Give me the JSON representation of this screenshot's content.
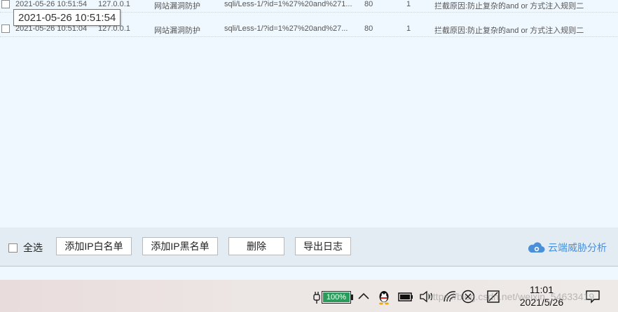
{
  "log_rows": [
    {
      "time": "2021-05-26 10:51:54",
      "ip": "127.0.0.1",
      "type": "网站漏洞防护",
      "url": "sqli/Less-1/?id=1%27%20and%271...",
      "port": "80",
      "count": "1",
      "reason": "拦截原因:防止复杂的and or 方式注入规则二"
    },
    {
      "time": "2021-05-26 10:51:04",
      "ip": "127.0.0.1",
      "type": "网站漏洞防护",
      "url": "sqli/Less-1/?id=1%27%20and%27...",
      "port": "80",
      "count": "1",
      "reason": "拦截原因:防止复杂的and or 方式注入规则二"
    }
  ],
  "tooltip": "2021-05-26 10:51:54",
  "footer": {
    "select_all": "全选",
    "add_whitelist": "添加IP白名单",
    "add_blacklist": "添加IP黑名单",
    "delete": "删除",
    "export": "导出日志",
    "cloud_analysis": "云端威胁分析"
  },
  "taskbar": {
    "battery_level": "100%",
    "time": "11:01",
    "date": "2021/5/26",
    "watermark": "https://blog.csdn.net/weixin_54633419"
  },
  "colors": {
    "log_background": "#f0f8ff",
    "footer_background": "#e3ecf2",
    "accent_link": "#4a90d9",
    "battery_fill": "#2a9b5a"
  },
  "icons": {
    "cloud": "cloud-eye-icon",
    "plug": "power-plug-icon",
    "chevron": "chevron-up-icon",
    "qq": "qq-penguin-icon",
    "keyboard": "keyboard-icon",
    "volume": "speaker-icon",
    "wifi": "wifi-icon",
    "x_circle": "x-circle-icon",
    "action": "action-center-icon",
    "notification": "notification-icon"
  }
}
